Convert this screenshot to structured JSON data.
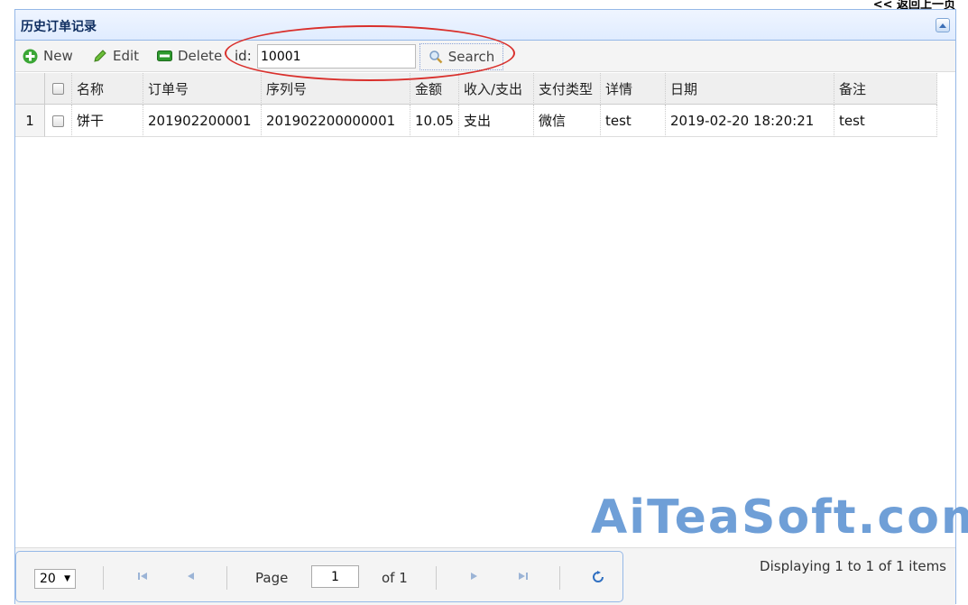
{
  "back_link": "<< 返回上一页",
  "panel": {
    "title": "历史订单记录"
  },
  "toolbar": {
    "new_label": "New",
    "edit_label": "Edit",
    "delete_label": "Delete",
    "id_label": "id:",
    "id_value": "10001",
    "search_label": "Search"
  },
  "grid": {
    "columns": [
      "名称",
      "订单号",
      "序列号",
      "金额",
      "收入/支出",
      "支付类型",
      "详情",
      "日期",
      "备注"
    ],
    "rows": [
      {
        "num": "1",
        "cells": [
          "饼干",
          "201902200001",
          "201902200000001",
          "10.05",
          "支出",
          "微信",
          "test",
          "2019-02-20 18:20:21",
          "test"
        ]
      }
    ]
  },
  "pager": {
    "page_size": "20",
    "page_label": "Page",
    "page_value": "1",
    "of_label": "of 1",
    "display_info": "Displaying 1 to 1 of 1 items"
  },
  "watermark": "AiTeaSoft.com",
  "colors": {
    "header_border": "#95b8e7",
    "highlight": "#d9302c",
    "watermark": "#6f9fd7"
  }
}
